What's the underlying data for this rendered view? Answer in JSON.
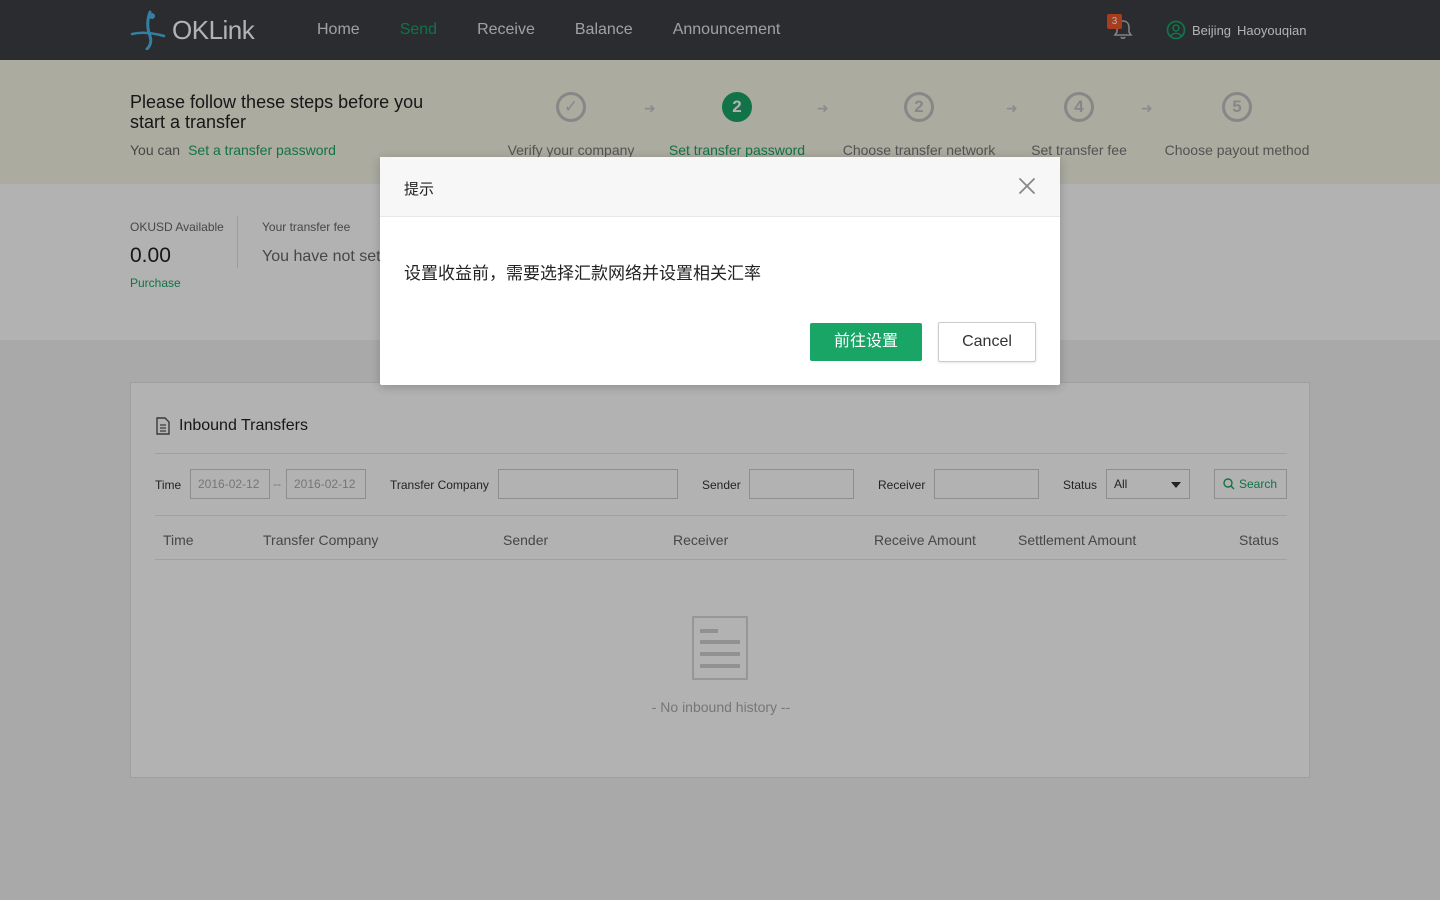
{
  "header": {
    "brand": "OKLink",
    "nav": [
      "Home",
      "Send",
      "Receive",
      "Balance",
      "Announcement"
    ],
    "active_nav": "Send",
    "notification_count": "3",
    "user_first": "Beijing",
    "user_last": "Haoyouqian"
  },
  "steps": {
    "title": "Please follow these steps before you start a transfer",
    "sub_prefix": "You can",
    "sub_link": "Set a transfer password",
    "items": [
      {
        "num": "✓",
        "label": "Verify your company",
        "state": "done"
      },
      {
        "num": "2",
        "label": "Set transfer password",
        "state": "active"
      },
      {
        "num": "2",
        "label": "Choose transfer network",
        "state": "todo"
      },
      {
        "num": "4",
        "label": "Set transfer fee",
        "state": "todo"
      },
      {
        "num": "5",
        "label": "Choose payout method",
        "state": "todo"
      }
    ]
  },
  "balance": {
    "label": "OKUSD Available",
    "value": "0.00",
    "link": "Purchase",
    "fee_label": "Your transfer fee",
    "fee_value": "You have not set"
  },
  "inbound": {
    "title": "Inbound Transfers",
    "filters": {
      "time_label": "Time",
      "date_from": "2016-02-12",
      "date_sep": "--",
      "date_to": "2016-02-12",
      "company_label": "Transfer Company",
      "sender_label": "Sender",
      "receiver_label": "Receiver",
      "status_label": "Status",
      "status_value": "All",
      "search_label": "Search"
    },
    "columns": [
      "Time",
      "Transfer Company",
      "Sender",
      "Receiver",
      "Receive Amount",
      "Settlement Amount",
      "Status"
    ],
    "empty_text": "- No inbound history --"
  },
  "modal": {
    "title": "提示",
    "message": "设置收益前，需要选择汇款网络并设置相关汇率",
    "confirm": "前往设置",
    "cancel": "Cancel"
  },
  "colors": {
    "accent": "#19a566",
    "topbar": "#3d4046",
    "step_band": "#f5f5e6",
    "badge": "#f0582a"
  }
}
